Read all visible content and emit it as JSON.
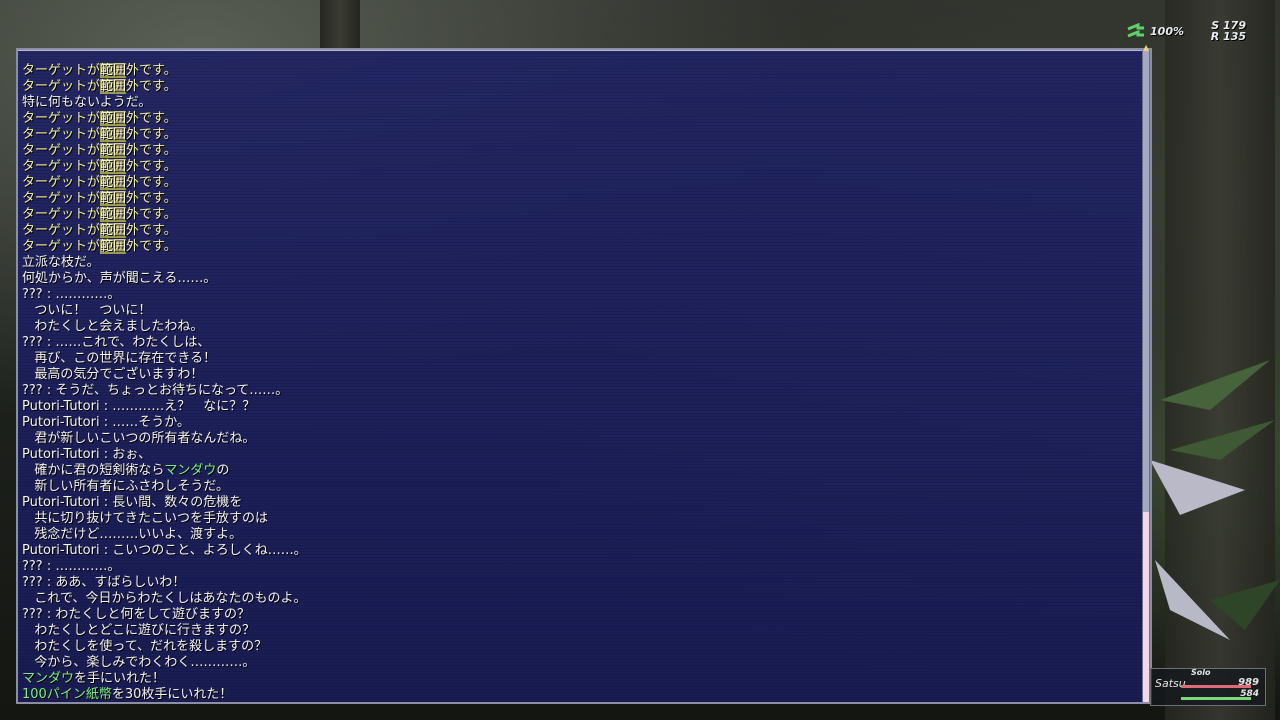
{
  "hud": {
    "percent": "100%",
    "s_value": "S 179",
    "r_value": "R 135"
  },
  "party": {
    "mode": "Solo",
    "name": "Satsu",
    "hp": "989",
    "mp": "584",
    "hp_fraction": 1.0,
    "mp_fraction": 1.0,
    "hp_color": "#e0697a",
    "mp_color": "#7bd87b"
  },
  "colors": {
    "window_bg": "#212466",
    "system_yellow": "#f4f39d",
    "item_green": "#7cf07c"
  },
  "chat_log": [
    {
      "style": "yellow",
      "parts": [
        {
          "t": "ターゲットが"
        },
        {
          "t": "範囲",
          "cls": "hl"
        },
        {
          "t": "外です。"
        }
      ]
    },
    {
      "style": "yellow",
      "parts": [
        {
          "t": "ターゲットが"
        },
        {
          "t": "範囲",
          "cls": "hl"
        },
        {
          "t": "外です。"
        }
      ]
    },
    {
      "style": "",
      "parts": [
        {
          "t": "特に何もないようだ。"
        }
      ]
    },
    {
      "style": "yellow",
      "parts": [
        {
          "t": "ターゲットが"
        },
        {
          "t": "範囲",
          "cls": "hl"
        },
        {
          "t": "外です。"
        }
      ]
    },
    {
      "style": "yellow",
      "parts": [
        {
          "t": "ターゲットが"
        },
        {
          "t": "範囲",
          "cls": "hl"
        },
        {
          "t": "外です。"
        }
      ]
    },
    {
      "style": "yellow",
      "parts": [
        {
          "t": "ターゲットが"
        },
        {
          "t": "範囲",
          "cls": "hl"
        },
        {
          "t": "外です。"
        }
      ]
    },
    {
      "style": "yellow",
      "parts": [
        {
          "t": "ターゲットが"
        },
        {
          "t": "範囲",
          "cls": "hl"
        },
        {
          "t": "外です。"
        }
      ]
    },
    {
      "style": "yellow",
      "parts": [
        {
          "t": "ターゲットが"
        },
        {
          "t": "範囲",
          "cls": "hl"
        },
        {
          "t": "外です。"
        }
      ]
    },
    {
      "style": "yellow",
      "parts": [
        {
          "t": "ターゲットが"
        },
        {
          "t": "範囲",
          "cls": "hl"
        },
        {
          "t": "外です。"
        }
      ]
    },
    {
      "style": "yellow",
      "parts": [
        {
          "t": "ターゲットが"
        },
        {
          "t": "範囲",
          "cls": "hl"
        },
        {
          "t": "外です。"
        }
      ]
    },
    {
      "style": "yellow",
      "parts": [
        {
          "t": "ターゲットが"
        },
        {
          "t": "範囲",
          "cls": "hl"
        },
        {
          "t": "外です。"
        }
      ]
    },
    {
      "style": "yellow",
      "parts": [
        {
          "t": "ターゲットが"
        },
        {
          "t": "範囲",
          "cls": "hl"
        },
        {
          "t": "外です。"
        }
      ]
    },
    {
      "style": "",
      "parts": [
        {
          "t": "立派な枝だ。"
        }
      ]
    },
    {
      "style": "",
      "parts": [
        {
          "t": "何処からか、声が聞こえる……。"
        }
      ]
    },
    {
      "style": "",
      "parts": [
        {
          "t": "??? : …………。"
        }
      ]
    },
    {
      "style": "",
      "parts": [
        {
          "t": "   ついに！　ついに！"
        }
      ]
    },
    {
      "style": "",
      "parts": [
        {
          "t": "   わたくしと会えましたわね。"
        }
      ]
    },
    {
      "style": "",
      "parts": [
        {
          "t": "??? : ……これで、わたくしは、"
        }
      ]
    },
    {
      "style": "",
      "parts": [
        {
          "t": "   再び、この世界に存在できる！"
        }
      ]
    },
    {
      "style": "",
      "parts": [
        {
          "t": "   最高の気分でございますわ！"
        }
      ]
    },
    {
      "style": "",
      "parts": [
        {
          "t": "??? : そうだ、ちょっとお待ちになって……。"
        }
      ]
    },
    {
      "style": "",
      "parts": [
        {
          "t": "Putori-Tutori : …………え？　なに？？"
        }
      ]
    },
    {
      "style": "",
      "parts": [
        {
          "t": "Putori-Tutori : ……そうか。"
        }
      ]
    },
    {
      "style": "",
      "parts": [
        {
          "t": "   君が新しいこいつの所有者なんだね。"
        }
      ]
    },
    {
      "style": "",
      "parts": [
        {
          "t": "Putori-Tutori : おぉ、"
        }
      ]
    },
    {
      "style": "",
      "parts": [
        {
          "t": "   確かに君の短剣術なら"
        },
        {
          "t": "マンダウ",
          "cls": "item"
        },
        {
          "t": "の"
        }
      ]
    },
    {
      "style": "",
      "parts": [
        {
          "t": "   新しい所有者にふさわしそうだ。"
        }
      ]
    },
    {
      "style": "",
      "parts": [
        {
          "t": "Putori-Tutori : 長い間、数々の危機を"
        }
      ]
    },
    {
      "style": "",
      "parts": [
        {
          "t": "   共に切り抜けてきたこいつを手放すのは"
        }
      ]
    },
    {
      "style": "",
      "parts": [
        {
          "t": "   残念だけど………いいよ、渡すよ。"
        }
      ]
    },
    {
      "style": "",
      "parts": [
        {
          "t": "Putori-Tutori : こいつのこと、よろしくね……。"
        }
      ]
    },
    {
      "style": "",
      "parts": [
        {
          "t": "??? : …………。"
        }
      ]
    },
    {
      "style": "",
      "parts": [
        {
          "t": "??? : ああ、すばらしいわ！"
        }
      ]
    },
    {
      "style": "",
      "parts": [
        {
          "t": "   これで、今日からわたくしはあなたのものよ。"
        }
      ]
    },
    {
      "style": "",
      "parts": [
        {
          "t": "??? : わたくしと何をして遊びますの？"
        }
      ]
    },
    {
      "style": "",
      "parts": [
        {
          "t": "   わたくしとどこに遊びに行きますの？"
        }
      ]
    },
    {
      "style": "",
      "parts": [
        {
          "t": "   わたくしを使って、だれを殺しますの？"
        }
      ]
    },
    {
      "style": "",
      "parts": [
        {
          "t": "   今から、楽しみでわくわく…………。"
        }
      ]
    },
    {
      "style": "",
      "parts": [
        {
          "t": "マンダウ",
          "cls": "item"
        },
        {
          "t": "を手にいれた！"
        }
      ]
    },
    {
      "style": "",
      "parts": [
        {
          "t": "100パイン紙幣",
          "cls": "item"
        },
        {
          "t": "を30枚手にいれた！"
        }
      ]
    }
  ]
}
